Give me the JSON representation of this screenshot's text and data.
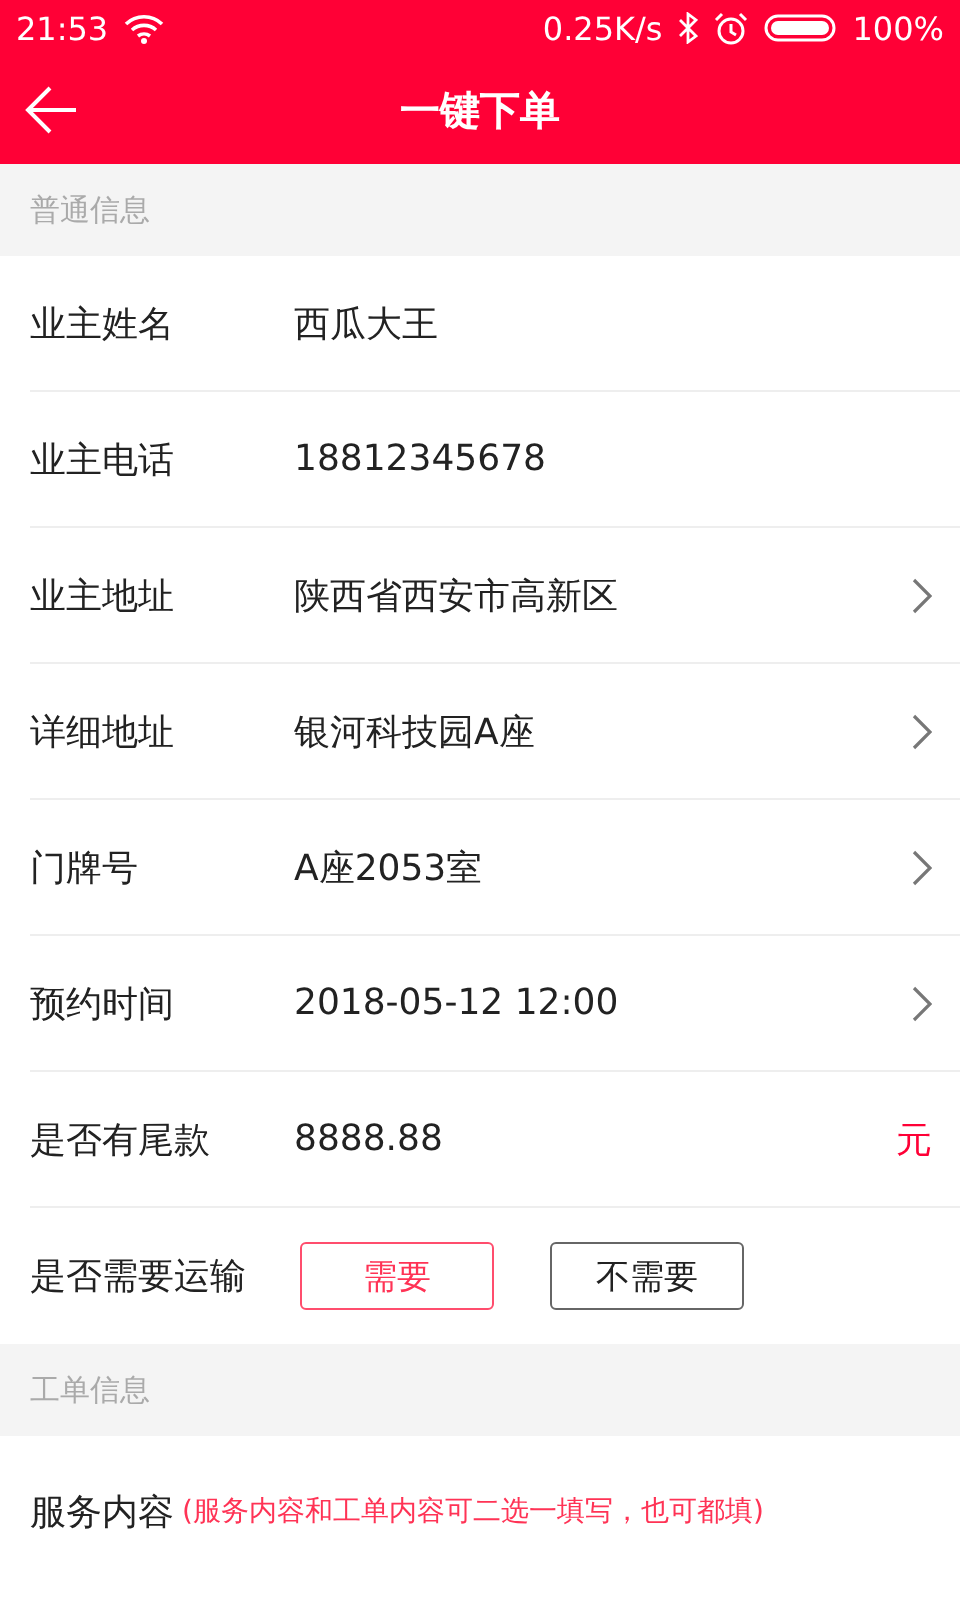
{
  "status_bar": {
    "time": "21:53",
    "speed": "0.25K/s",
    "battery": "100%"
  },
  "toolbar": {
    "title": "一键下单"
  },
  "sections": [
    {
      "title": "普通信息",
      "rows": [
        {
          "kind": "text",
          "label": "业主姓名",
          "value": "西瓜大王"
        },
        {
          "kind": "text",
          "label": "业主电话",
          "value": "18812345678"
        },
        {
          "kind": "link",
          "label": "业主地址",
          "value": "陕西省西安市高新区"
        },
        {
          "kind": "link",
          "label": "详细地址",
          "value": "银河科技园A座"
        },
        {
          "kind": "link",
          "label": "门牌号",
          "value": "A座2053室"
        },
        {
          "kind": "link",
          "label": "预约时间",
          "value": "2018-05-12 12:00"
        },
        {
          "kind": "amount",
          "label": "是否有尾款",
          "value": "8888.88",
          "unit": "元"
        },
        {
          "kind": "choice",
          "label": "是否需要运输",
          "options": [
            {
              "label": "需要",
              "selected": true
            },
            {
              "label": "不需要",
              "selected": false
            }
          ]
        }
      ]
    },
    {
      "title": "工单信息",
      "rows": [
        {
          "kind": "note",
          "label": "服务内容",
          "note": "(服务内容和工单内容可二选一填写，也可都填)"
        }
      ]
    }
  ]
}
